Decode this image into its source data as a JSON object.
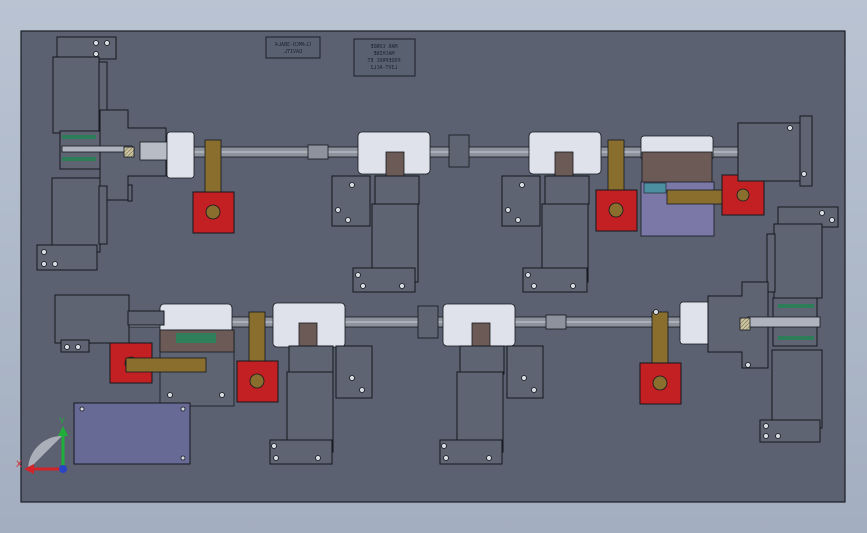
{
  "viewport": {
    "background_top": "#b9c3d2",
    "background_bottom": "#a3aec0",
    "plate_color": "#5b6170",
    "part_color": "#5e6472",
    "part_outline": "#15181e",
    "motor_flange_color": "#c32024",
    "arm_color": "#8a6e2e",
    "block_color": "#dfe2ea",
    "green_accent": "#2f7f5a"
  },
  "nameplates": [
    {
      "name": "nameplate-left",
      "lines": [
        "CL4MCO-3BAL4",
        "DAVITL"
      ],
      "mirrored": true
    },
    {
      "name": "nameplate-right",
      "lines": [
        "MAR CONDE",
        "MACHINE",
        "PODEPROC ET",
        "L3VT-ACL2"
      ],
      "mirrored": true
    }
  ],
  "triad": {
    "y_label": "Y",
    "x_label": "X",
    "y_color": "#1fae3a",
    "x_color": "#d2232a"
  }
}
